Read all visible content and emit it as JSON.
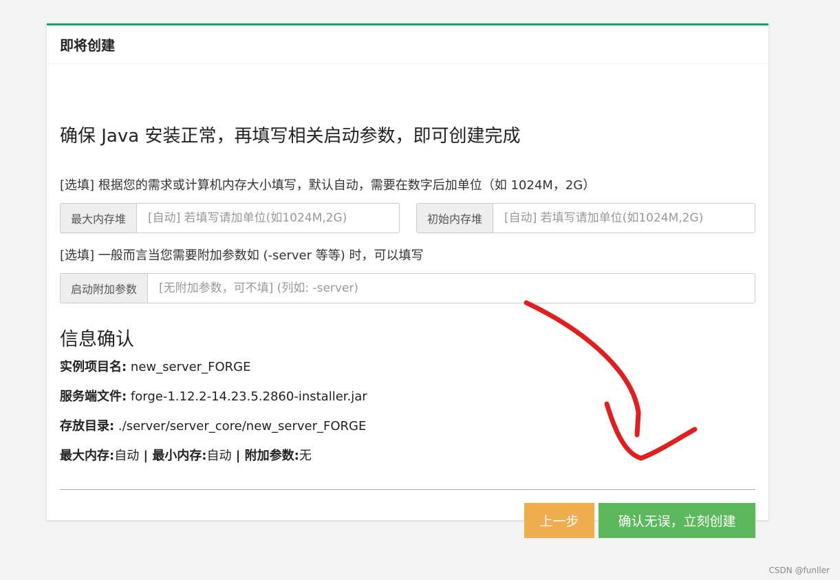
{
  "card": {
    "title": "即将创建",
    "headline": "确保 Java 安装正常，再填写相关启动参数，即可创建完成"
  },
  "memory": {
    "hint": "[选填] 根据您的需求或计算机内存大小填写，默认自动，需要在数字后加单位（如 1024M，2G）",
    "max_heap_label": "最大内存堆",
    "max_heap_placeholder": "[自动] 若填写请加单位(如1024M,2G)",
    "max_heap_value": "",
    "init_heap_label": "初始内存堆",
    "init_heap_placeholder": "[自动] 若填写请加单位(如1024M,2G)",
    "init_heap_value": ""
  },
  "extra_args": {
    "hint": "[选填] 一般而言当您需要附加参数如 (-server 等等) 时，可以填写",
    "label": "启动附加参数",
    "placeholder": "[无附加参数，可不填] (列如: -server)",
    "value": ""
  },
  "confirm": {
    "title": "信息确认",
    "instance_name_label": "实例项目名:",
    "instance_name_value": " new_server_FORGE",
    "server_file_label": "服务端文件:",
    "server_file_value": " forge-1.12.2-14.23.5.2860-installer.jar",
    "directory_label": "存放目录:",
    "directory_value": " ./server/server_core/new_server_FORGE",
    "max_mem_label": "最大内存:",
    "max_mem_value": "自动",
    "sep1": " | ",
    "min_mem_label": "最小内存:",
    "min_mem_value": "自动",
    "sep2": " | ",
    "extra_label": "附加参数:",
    "extra_value": "无"
  },
  "buttons": {
    "prev": "上一步",
    "create": "确认无误，立刻创建"
  },
  "colors": {
    "accent_top": "#1aa55f",
    "prev_button": "#f0ad4e",
    "create_button": "#5cb85c",
    "annotation_arrow": "#e02020"
  },
  "watermark": "CSDN @funller"
}
